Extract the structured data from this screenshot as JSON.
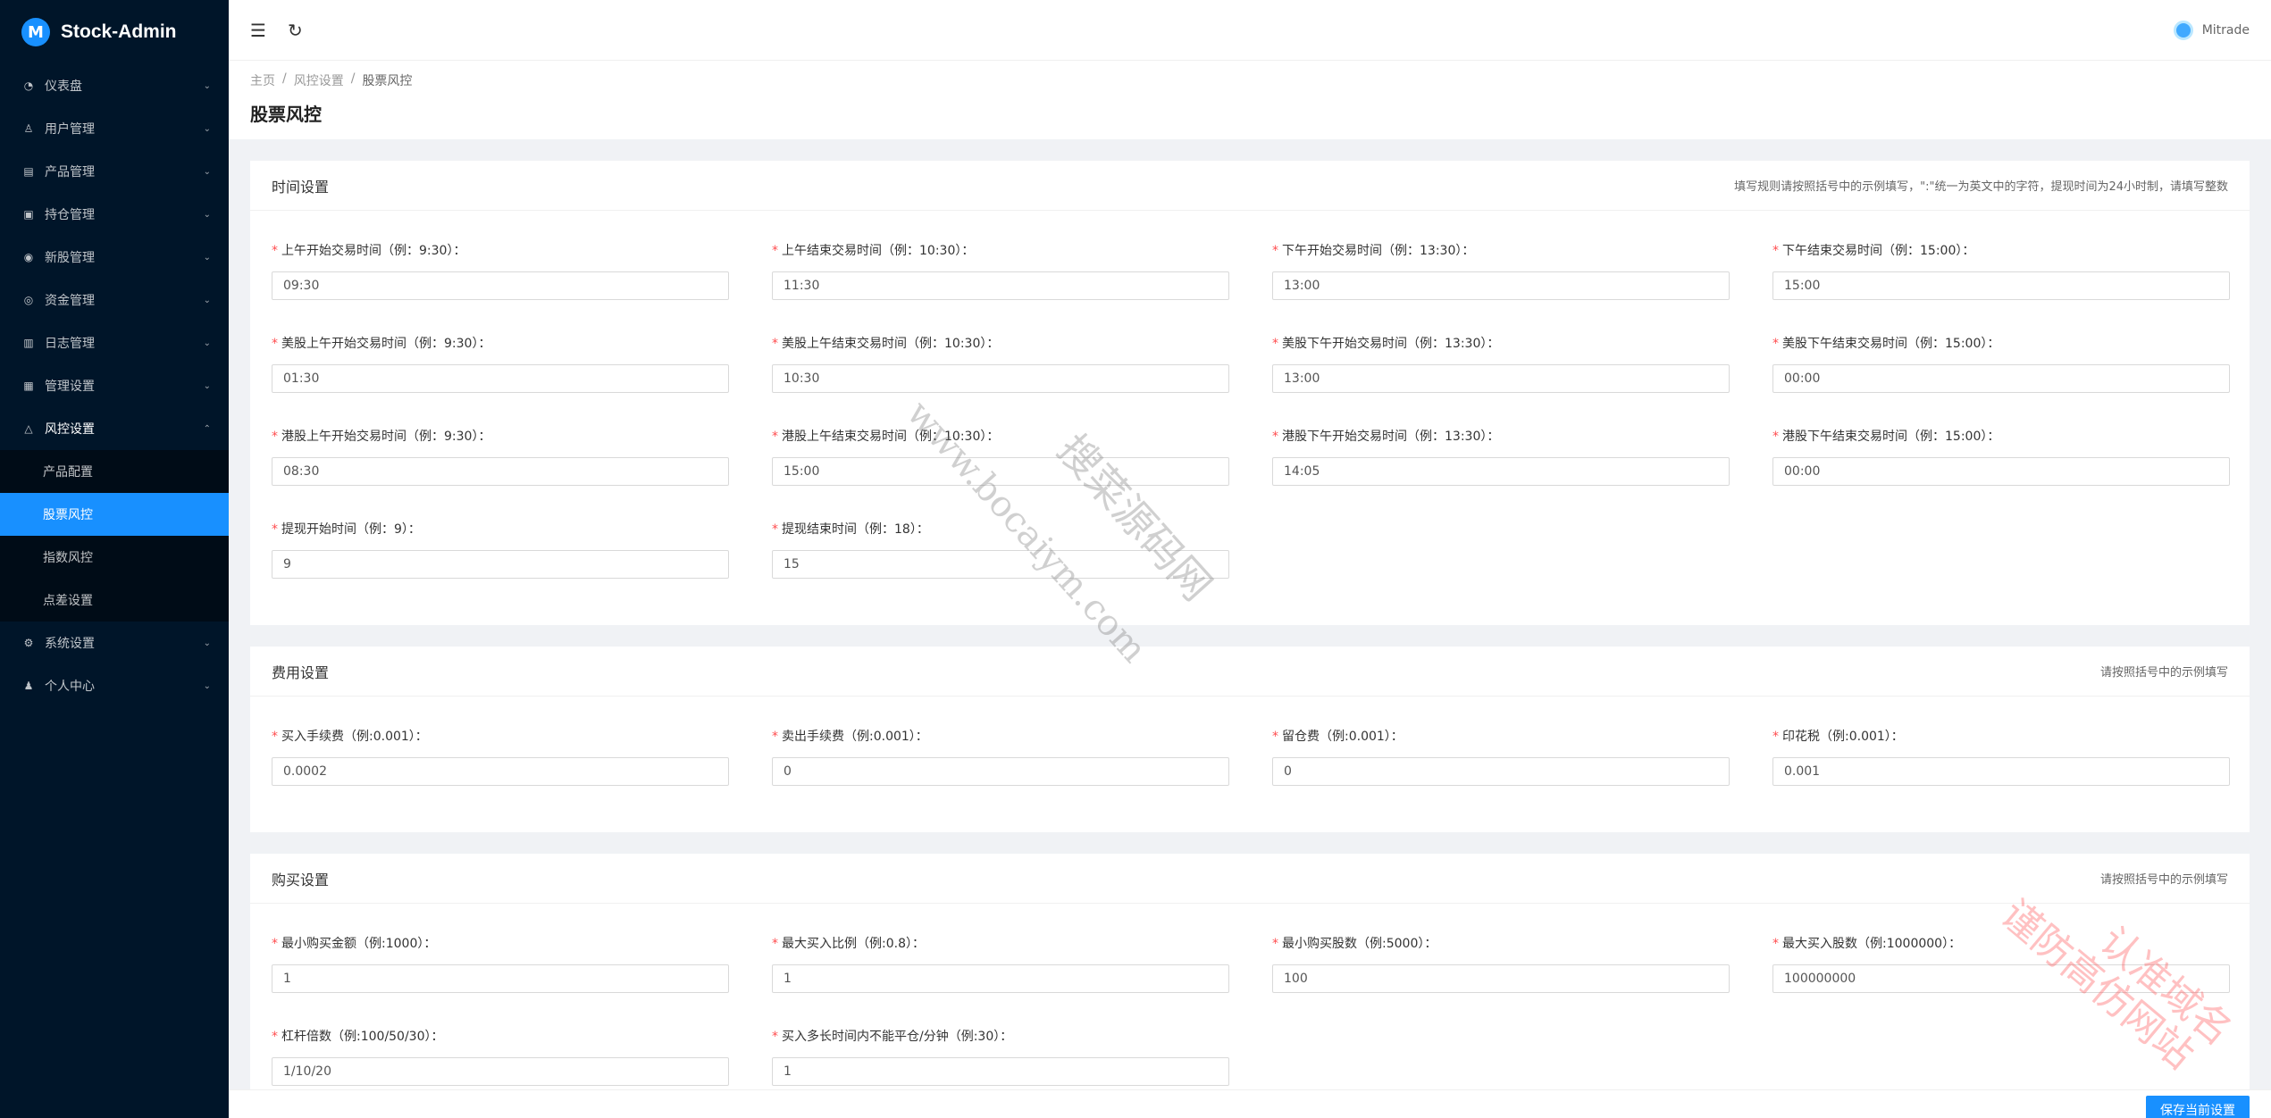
{
  "app": {
    "title": "Stock-Admin",
    "logo_glyph": "M"
  },
  "sidebar": {
    "items": [
      {
        "label": "仪表盘",
        "icon": "dashboard-icon"
      },
      {
        "label": "用户管理",
        "icon": "user-icon"
      },
      {
        "label": "产品管理",
        "icon": "chart-icon"
      },
      {
        "label": "持仓管理",
        "icon": "file-icon"
      },
      {
        "label": "新股管理",
        "icon": "broadcast-icon"
      },
      {
        "label": "资金管理",
        "icon": "coin-icon"
      },
      {
        "label": "日志管理",
        "icon": "log-icon"
      },
      {
        "label": "管理设置",
        "icon": "calendar-icon"
      },
      {
        "label": "风控设置",
        "icon": "warning-icon"
      },
      {
        "label": "系统设置",
        "icon": "gear-icon"
      },
      {
        "label": "个人中心",
        "icon": "person-icon"
      }
    ],
    "submenu": [
      "产品配置",
      "股票风控",
      "指数风控",
      "点差设置"
    ]
  },
  "header": {
    "username": "Mitrade"
  },
  "breadcrumb": [
    "主页",
    "风控设置",
    "股票风控"
  ],
  "breadcrumb_sep": "/",
  "page_title": "股票风控",
  "time": {
    "title": "时间设置",
    "hint": "填写规则请按照括号中的示例填写，\":\"统一为英文中的字符，提现时间为24小时制，请填写整数",
    "fields": [
      {
        "label": "上午开始交易时间（例：9:30）：",
        "value": "09:30"
      },
      {
        "label": "上午结束交易时间（例：10:30）：",
        "value": "11:30"
      },
      {
        "label": "下午开始交易时间（例：13:30）：",
        "value": "13:00"
      },
      {
        "label": "下午结束交易时间（例：15:00）：",
        "value": "15:00"
      },
      {
        "label": "美股上午开始交易时间（例：9:30）：",
        "value": "01:30"
      },
      {
        "label": "美股上午结束交易时间（例：10:30）：",
        "value": "10:30"
      },
      {
        "label": "美股下午开始交易时间（例：13:30）：",
        "value": "13:00"
      },
      {
        "label": "美股下午结束交易时间（例：15:00）：",
        "value": "00:00"
      },
      {
        "label": "港股上午开始交易时间（例：9:30）：",
        "value": "08:30"
      },
      {
        "label": "港股上午结束交易时间（例：10:30）：",
        "value": "15:00"
      },
      {
        "label": "港股下午开始交易时间（例：13:30）：",
        "value": "14:05"
      },
      {
        "label": "港股下午结束交易时间（例：15:00）：",
        "value": "00:00"
      },
      {
        "label": "提现开始时间（例：9）：",
        "value": "9"
      },
      {
        "label": "提现结束时间（例：18）：",
        "value": "15"
      }
    ]
  },
  "fee": {
    "title": "费用设置",
    "hint": "请按照括号中的示例填写",
    "fields": [
      {
        "label": "买入手续费（例:0.001）：",
        "value": "0.0002"
      },
      {
        "label": "卖出手续费（例:0.001）：",
        "value": "0"
      },
      {
        "label": "留仓费（例:0.001）：",
        "value": "0"
      },
      {
        "label": "印花税（例:0.001）：",
        "value": "0.001"
      }
    ]
  },
  "buy": {
    "title": "购买设置",
    "hint": "请按照括号中的示例填写",
    "fields": [
      {
        "label": "最小购买金额（例:1000）：",
        "value": "1"
      },
      {
        "label": "最大买入比例（例:0.8）：",
        "value": "1"
      },
      {
        "label": "最小购买股数（例:5000）：",
        "value": "100"
      },
      {
        "label": "最大买入股数（例:1000000）：",
        "value": "100000000"
      },
      {
        "label": "杠杆倍数（例:100/50/30）：",
        "value": "1/10/20"
      },
      {
        "label": "买入多长时间内不能平仓/分钟（例:30）：",
        "value": "1"
      }
    ]
  },
  "save_label": "保存当前设置",
  "watermark": {
    "url": "www.bocaiym.com",
    "cn": "搜菜源码网",
    "cn2": "谨防高仿网站",
    "cn3": "认准域名"
  },
  "colors": {
    "primary": "#1890ff",
    "sidebar": "#001529",
    "required": "#ff4d4f"
  }
}
